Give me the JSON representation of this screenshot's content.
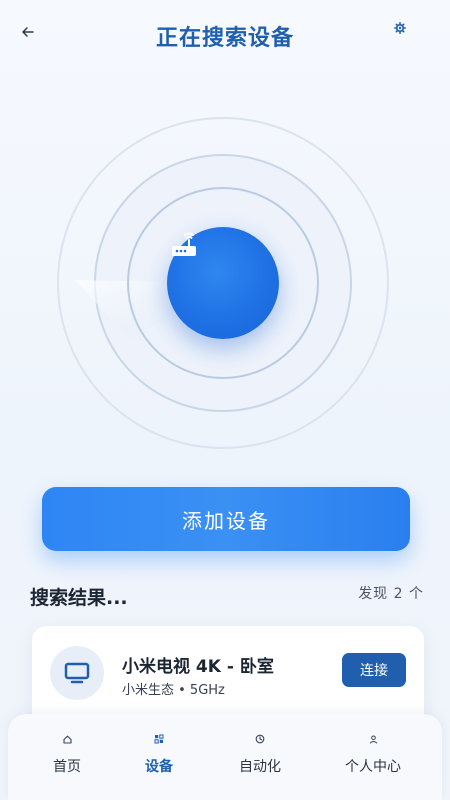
{
  "header": {
    "title": "正在搜索设备",
    "back_icon": "arrow-left-icon",
    "settings_icon": "gear-icon"
  },
  "radar": {
    "center_icon": "router-icon",
    "accent_color": "#1e6fe3"
  },
  "actions": {
    "add_device_label": "添加设备"
  },
  "results": {
    "heading": "搜索结果...",
    "count_label": "发现 2 个",
    "devices": [
      {
        "name": "小米电视 4K - 卧室",
        "meta": "小米生态 • 5GHz",
        "icon": "tv-icon",
        "connect_label": "连接"
      }
    ]
  },
  "nav": {
    "items": [
      {
        "label": "首页",
        "icon": "home-icon",
        "active": false
      },
      {
        "label": "设备",
        "icon": "devices-icon",
        "active": true
      },
      {
        "label": "自动化",
        "icon": "clock-icon",
        "active": false
      },
      {
        "label": "个人中心",
        "icon": "user-icon",
        "active": false
      }
    ]
  },
  "colors": {
    "primary": "#1f5fae",
    "button_gradient_start": "#2e86f5",
    "background": "#f3f7fd"
  }
}
